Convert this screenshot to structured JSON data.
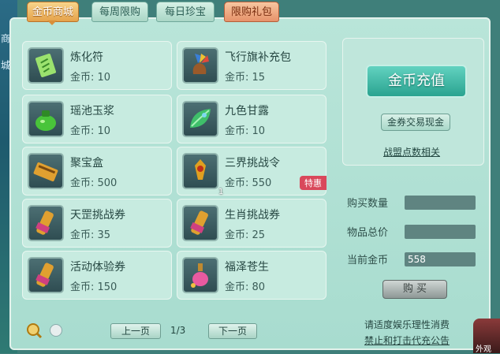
{
  "side": {
    "top": "商",
    "bottom": "城"
  },
  "tabs": [
    {
      "label": "金币商城"
    },
    {
      "label": "每周限购"
    },
    {
      "label": "每日珍宝"
    },
    {
      "label": "限购礼包"
    }
  ],
  "items": [
    {
      "name": "炼化符",
      "price": "金币: 10"
    },
    {
      "name": "飞行旗补充包",
      "price": "金币: 15"
    },
    {
      "name": "瑶池玉浆",
      "price": "金币: 10"
    },
    {
      "name": "九色甘露",
      "price": "金币: 10"
    },
    {
      "name": "聚宝盒",
      "price": "金币: 500"
    },
    {
      "name": "三界挑战令",
      "price": "金币: 550",
      "count": "1",
      "badge": "特惠"
    },
    {
      "name": "天罡挑战券",
      "price": "金币: 35"
    },
    {
      "name": "生肖挑战券",
      "price": "金币: 25"
    },
    {
      "name": "活动体验券",
      "price": "金币: 150"
    },
    {
      "name": "福泽苍生",
      "price": "金币: 80"
    }
  ],
  "right": {
    "charge": "金币充值",
    "exchange": "金券交易现金",
    "alliance": "战盟点数相关",
    "qty_label": "购买数量",
    "qty_value": "",
    "total_label": "物品总价",
    "total_value": "",
    "gold_label": "当前金币",
    "gold_value": "558",
    "buy": "购 买"
  },
  "pager": {
    "prev": "上一页",
    "page": "1/3",
    "next": "下一页"
  },
  "notice": {
    "line1": "请适度娱乐理性消费",
    "line2": "禁止和打击代充公告"
  },
  "corner": {
    "label": "外观"
  }
}
